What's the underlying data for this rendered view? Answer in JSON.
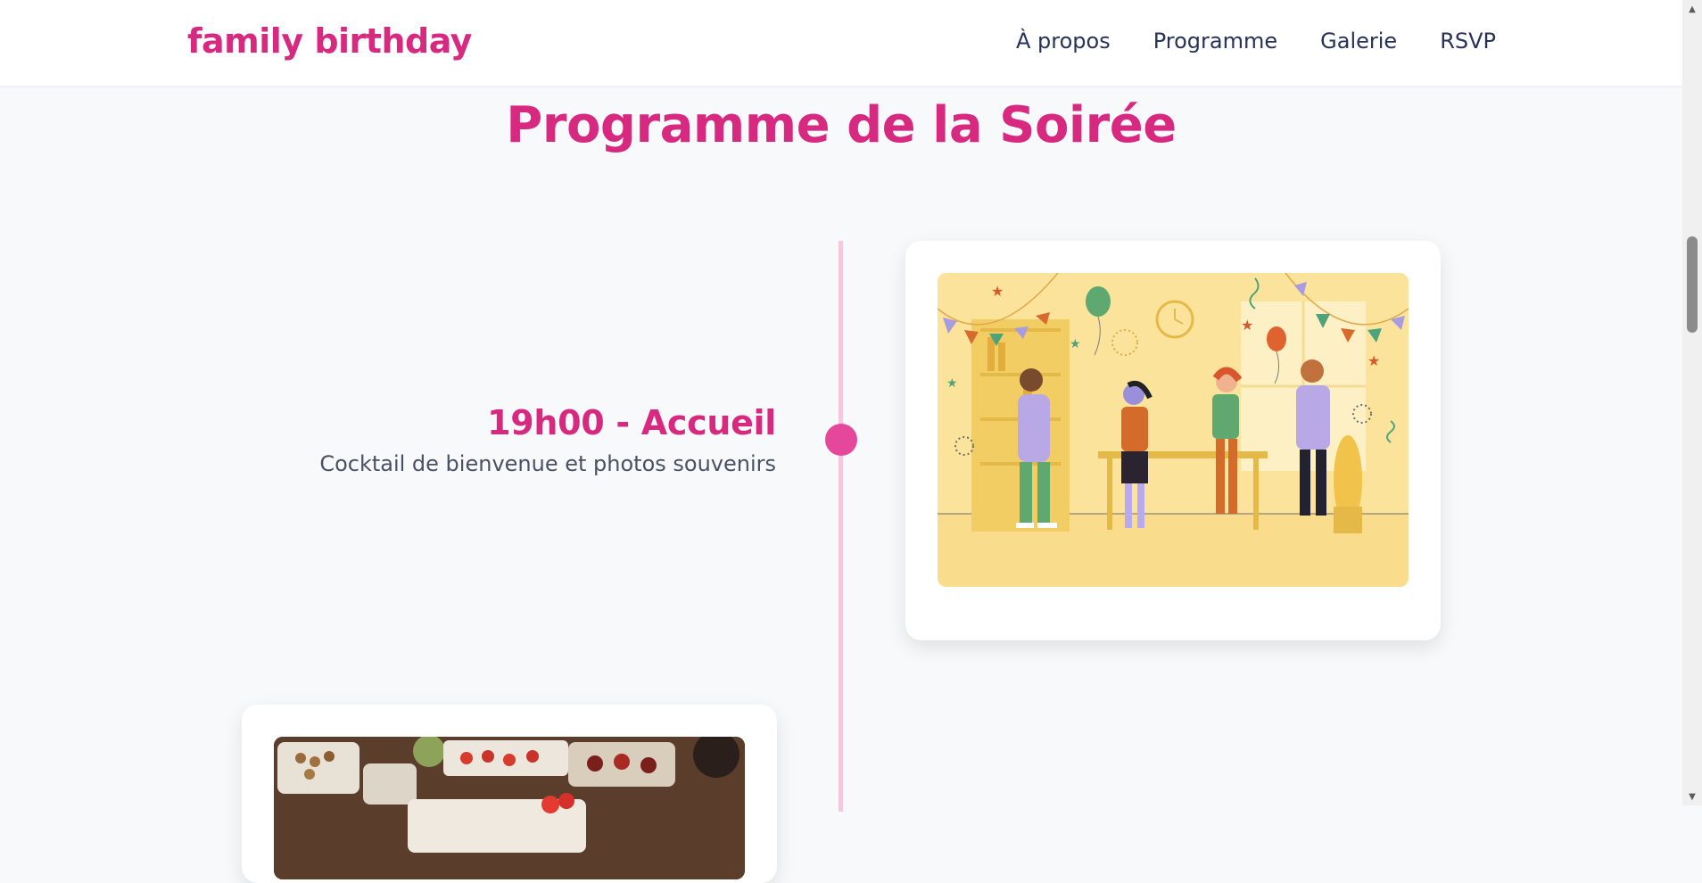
{
  "brand": {
    "name": "family birthday",
    "color": "#d6297f"
  },
  "nav": {
    "links": [
      {
        "label": "À propos"
      },
      {
        "label": "Programme"
      },
      {
        "label": "Galerie"
      },
      {
        "label": "RSVP"
      }
    ]
  },
  "section": {
    "title": "Programme de la Soirée"
  },
  "timeline": {
    "events": [
      {
        "title": "19h00 - Accueil",
        "description": "Cocktail de bienvenue et photos souvenirs",
        "image_icon": "party-illustration"
      },
      {
        "title": "",
        "description": "",
        "image_icon": "food-buffet-photo"
      }
    ]
  },
  "colors": {
    "accent": "#d6297f",
    "timeline_line": "#f7c6df",
    "timeline_dot": "#e5489b",
    "nav_text": "#27325a",
    "body_text": "#4a5164",
    "page_bg": "#f8f9fb"
  }
}
